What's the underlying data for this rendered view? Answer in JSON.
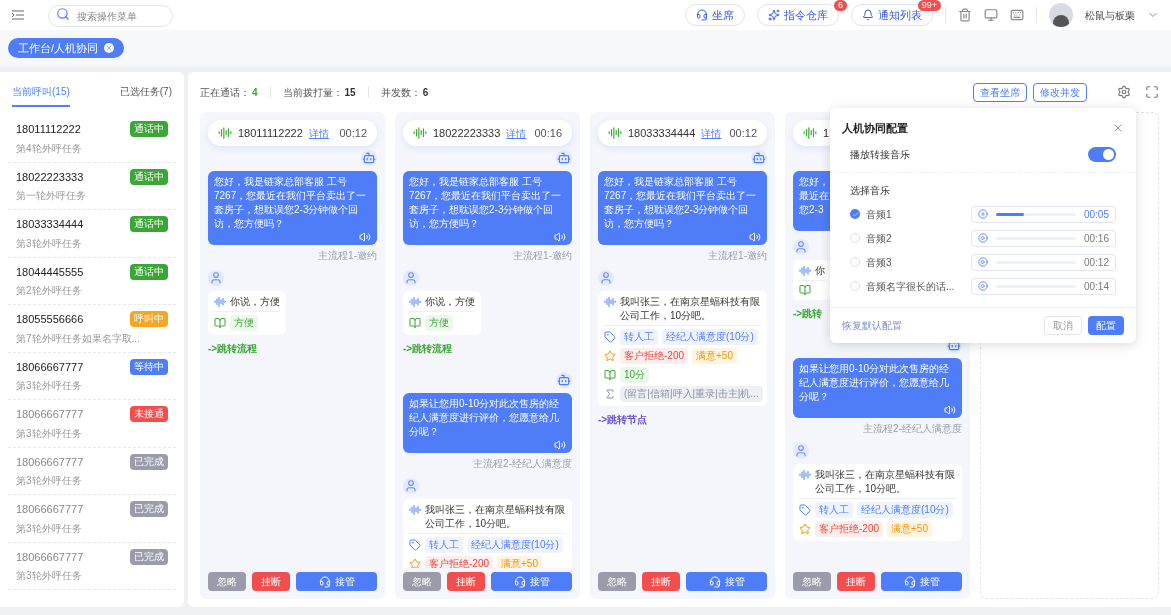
{
  "topbar": {
    "search": {
      "placeholder": "搜索操作菜单"
    },
    "actions": [
      {
        "label": "坐席",
        "kind": "headset"
      },
      {
        "label": "指令仓库",
        "kind": "spark",
        "badge": "6"
      },
      {
        "label": "通知列表",
        "kind": "bell",
        "badge": "99+"
      }
    ],
    "user": "松鼠与板栗"
  },
  "breadcrumb_tab": "工作台/人机协同",
  "sidebar": {
    "tabs": [
      {
        "label": "当前呼叫",
        "count": "(15)",
        "selected": true
      },
      {
        "label": "已选任务",
        "count": "(7)",
        "selected": false
      }
    ],
    "calls": [
      {
        "phone": "18011112222",
        "task": "第4轮外呼任务",
        "status": "通话中",
        "color": "#3aa635",
        "muted": false
      },
      {
        "phone": "18022223333",
        "task": "第一轮外呼任务",
        "status": "通话中",
        "color": "#3aa635",
        "muted": false
      },
      {
        "phone": "18033334444",
        "task": "第3轮外呼任务",
        "status": "通话中",
        "color": "#3aa635",
        "muted": false
      },
      {
        "phone": "18044445555",
        "task": "第2轮外呼任务",
        "status": "通话中",
        "color": "#3aa635",
        "muted": false
      },
      {
        "phone": "18055556666",
        "task": "第7轮外呼任务如果名字取...",
        "status": "呼叫中",
        "color": "#f5a623",
        "muted": false
      },
      {
        "phone": "18066667777",
        "task": "第3轮外呼任务",
        "status": "等待中",
        "color": "#4f7cf7",
        "muted": false
      },
      {
        "phone": "18066667777",
        "task": "第3轮外呼任务",
        "status": "未接通",
        "color": "#f24e4e",
        "muted": true
      },
      {
        "phone": "18066667777",
        "task": "第3轮外呼任务",
        "status": "已完成",
        "color": "#9a9cab",
        "muted": true
      },
      {
        "phone": "18066667777",
        "task": "第3轮外呼任务",
        "status": "已完成",
        "color": "#9a9cab",
        "muted": true
      },
      {
        "phone": "18066667777",
        "task": "第3轮外呼任务",
        "status": "已完成",
        "color": "#9a9cab",
        "muted": true
      }
    ]
  },
  "stats": [
    {
      "label": "正在通话：",
      "value": "4",
      "color": "#3aa635"
    },
    {
      "label": "当前拨打量：",
      "value": "15",
      "color": "#333333"
    },
    {
      "label": "并发数：",
      "value": "6",
      "color": "#333333"
    }
  ],
  "toolbar_buttons": [
    "查看坐席",
    "修改并发"
  ],
  "calls": [
    {
      "phone": "18011112222",
      "detail": "详情",
      "time": "00:12",
      "buttons": [
        "忽略",
        "挂断",
        "接管"
      ],
      "messages": [
        {
          "kind": "bot",
          "text": "您好，我是链家总部客服 工号7267，您最近在我们平台卖出了一套房子，想耽误您2-3分钟做个回访，您方便吗？",
          "flow": "主流程1-邀约"
        },
        {
          "kind": "user",
          "speech": "你说，方便",
          "rows": [
            {
              "kind": "book",
              "chips": [
                {
                  "text": "方便",
                  "kind": "success"
                }
              ]
            }
          ]
        },
        {
          "kind": "jump",
          "text": "->跳转流程",
          "color": "#3aa635"
        }
      ]
    },
    {
      "phone": "18022223333",
      "detail": "详情",
      "time": "00:16",
      "buttons": [
        "忽略",
        "挂断",
        "接管"
      ],
      "messages": [
        {
          "kind": "bot",
          "text": "您好，我是链家总部客服 工号7267，您最近在我们平台卖出了一套房子，想耽误您2-3分钟做个回访，您方便吗？",
          "flow": "主流程1-邀约"
        },
        {
          "kind": "user",
          "speech": "你说，方便",
          "rows": [
            {
              "kind": "book",
              "chips": [
                {
                  "text": "方便",
                  "kind": "success"
                }
              ]
            }
          ]
        },
        {
          "kind": "jump",
          "text": "->跳转流程",
          "color": "#3aa635"
        },
        {
          "kind": "bot",
          "text": "如果让您用0-10分对此次售房的经纪人满意度进行评价，您愿意给几分呢？",
          "flow": "主流程2-经纪人满意度"
        },
        {
          "kind": "user",
          "speech": "我叫张三，在南京星蝠科技有限公司工作，10分吧。",
          "rows": [
            {
              "kind": "tag",
              "chips": [
                {
                  "text": "转人工",
                  "kind": "info"
                },
                {
                  "text": "经纪人满意度(10分)",
                  "kind": "info"
                }
              ]
            },
            {
              "kind": "star",
              "chips": [
                {
                  "text": "客户拒绝-200",
                  "kind": "danger"
                },
                {
                  "text": "满意+50",
                  "kind": "warning"
                }
              ]
            }
          ]
        }
      ]
    },
    {
      "phone": "18033334444",
      "detail": "详情",
      "time": "00:12",
      "buttons": [
        "忽略",
        "挂断",
        "接管"
      ],
      "messages": [
        {
          "kind": "bot",
          "text": "您好，我是链家总部客服 工号7267，您最近在我们平台卖出了一套房子，想耽误您2-3分钟做个回访，您方便吗？",
          "flow": "主流程1-邀约"
        },
        {
          "kind": "user",
          "speech": "我叫张三，在南京星蝠科技有限公司工作，10分吧。",
          "rows": [
            {
              "kind": "tag",
              "chips": [
                {
                  "text": "转人工",
                  "kind": "info"
                },
                {
                  "text": "经纪人满意度(10分)",
                  "kind": "info"
                }
              ]
            },
            {
              "kind": "star",
              "chips": [
                {
                  "text": "客户拒绝-200",
                  "kind": "danger"
                },
                {
                  "text": "满意+50",
                  "kind": "warning"
                }
              ]
            },
            {
              "kind": "book",
              "chips": [
                {
                  "text": "10分",
                  "kind": "success"
                }
              ]
            },
            {
              "kind": "sum",
              "chips": [
                {
                  "text": "(留言|信箱|呼入|重录|击主|机...",
                  "kind": "neutral"
                }
              ]
            }
          ]
        },
        {
          "kind": "jump",
          "text": "->跳转节点",
          "color": "#6a4fd6"
        }
      ]
    },
    {
      "phone": "1",
      "buttons": [
        "忽略",
        "挂断",
        "接管"
      ],
      "messages": [
        {
          "kind": "bot",
          "lines": [
            "您好，",
            "最近在",
            "您2-3"
          ]
        },
        {
          "kind": "user",
          "speech": "你",
          "rows": [
            {
              "kind": "book"
            }
          ]
        },
        {
          "kind": "jump",
          "text": "->跳转",
          "color": "#3aa635"
        },
        {
          "kind": "bot",
          "text": "如果让您用0-10分对此次售房的经纪人满意度进行评价，您愿意给几分呢？",
          "flow": "主流程2-经纪人满意度"
        },
        {
          "kind": "user",
          "speech": "我叫张三，在南京星蝠科技有限公司工作，10分吧。",
          "rows": [
            {
              "kind": "tag",
              "chips": [
                {
                  "text": "转人工",
                  "kind": "info"
                },
                {
                  "text": "经纪人满意度(10分)",
                  "kind": "info"
                }
              ]
            },
            {
              "kind": "star",
              "chips": [
                {
                  "text": "客户拒绝-200",
                  "kind": "danger"
                },
                {
                  "text": "满意+50",
                  "kind": "warning"
                }
              ]
            }
          ]
        }
      ]
    }
  ],
  "config_panel": {
    "title": "人机协同配置",
    "music_toggle": {
      "label": "播放转接音乐",
      "on": true
    },
    "section": "选择音乐",
    "tracks": [
      {
        "name": "音频1",
        "selected": true,
        "playing": true,
        "level": 0.35,
        "time": "00:05"
      },
      {
        "name": "音频2",
        "selected": false,
        "playing": false,
        "level": 0,
        "time": "00:16"
      },
      {
        "name": "音频3",
        "selected": false,
        "playing": false,
        "level": 0,
        "time": "00:12"
      },
      {
        "name": "音频名字很长的话...",
        "selected": false,
        "playing": false,
        "level": 0,
        "time": "00:14"
      }
    ],
    "reset_link": "恢复默认配置",
    "cancel": "取消",
    "confirm": "配置"
  }
}
